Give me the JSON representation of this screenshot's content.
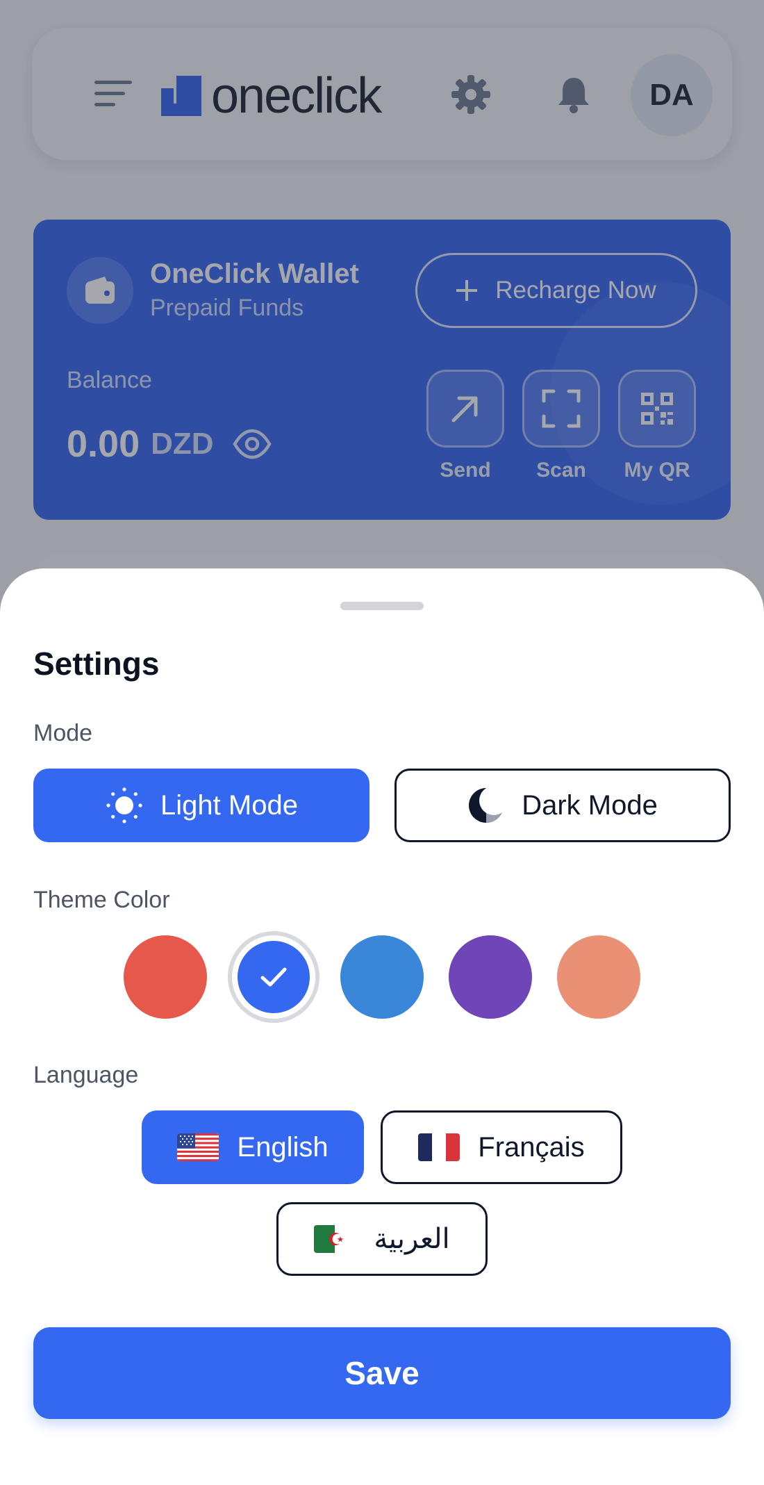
{
  "header": {
    "brand_name": "oneclick",
    "avatar_initials": "DA",
    "icons": {
      "menu": "menu-icon",
      "logo": "oneclick-logo-icon",
      "settings": "gear-icon",
      "notifications": "bell-icon"
    }
  },
  "wallet": {
    "title": "OneClick Wallet",
    "subtitle": "Prepaid Funds",
    "recharge_label": "Recharge Now",
    "balance_label": "Balance",
    "balance_amount": "0.00",
    "balance_currency": "DZD",
    "actions": [
      {
        "label": "Send",
        "icon": "arrow-up-right-icon"
      },
      {
        "label": "Scan",
        "icon": "scan-frame-icon"
      },
      {
        "label": "My QR",
        "icon": "qr-code-icon"
      }
    ]
  },
  "settings": {
    "title": "Settings",
    "mode_label": "Mode",
    "modes": [
      {
        "label": "Light Mode",
        "icon": "sun-icon",
        "selected": true
      },
      {
        "label": "Dark Mode",
        "icon": "moon-icon",
        "selected": false
      }
    ],
    "theme_label": "Theme Color",
    "theme_colors": [
      {
        "color": "#e5584b",
        "selected": false
      },
      {
        "color": "#3468f0",
        "selected": true
      },
      {
        "color": "#3a86d8",
        "selected": false
      },
      {
        "color": "#6f45b8",
        "selected": false
      },
      {
        "color": "#ea9074",
        "selected": false
      }
    ],
    "language_label": "Language",
    "languages": [
      {
        "label": "English",
        "flag": "us-flag-icon",
        "selected": true
      },
      {
        "label": "Français",
        "flag": "fr-flag-icon",
        "selected": false
      },
      {
        "label": "العربية",
        "flag": "dz-flag-icon",
        "selected": false
      }
    ],
    "save_label": "Save"
  },
  "colors": {
    "primary": "#3468f0",
    "wallet_card": "#2a5cf0",
    "text_dark": "#0f172a"
  }
}
